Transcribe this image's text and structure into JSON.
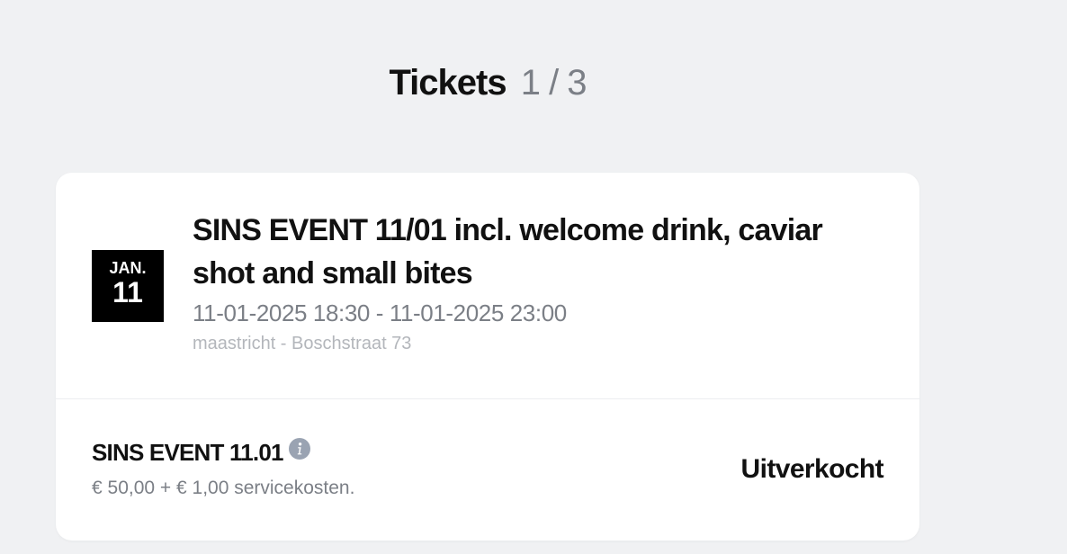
{
  "header": {
    "title": "Tickets",
    "counter": "1 / 3"
  },
  "event": {
    "date_badge": {
      "month": "JAN.",
      "day": "11"
    },
    "title": "SINS EVENT 11/01 incl. welcome drink, caviar shot and small bites",
    "datetime": "11-01-2025 18:30 - 11-01-2025 23:00",
    "location": "maastricht - Boschstraat 73"
  },
  "ticket": {
    "name": "SINS EVENT 11.01",
    "info_icon": "info-icon",
    "price": "€ 50,00 + € 1,00 servicekosten.",
    "status": "Uitverkocht"
  },
  "colors": {
    "background": "#f0f1f3",
    "card": "#ffffff",
    "muted_text": "#7b7f86",
    "light_text": "#b3b6bb",
    "info_icon": "#9aa3b2",
    "badge": "#000000"
  }
}
